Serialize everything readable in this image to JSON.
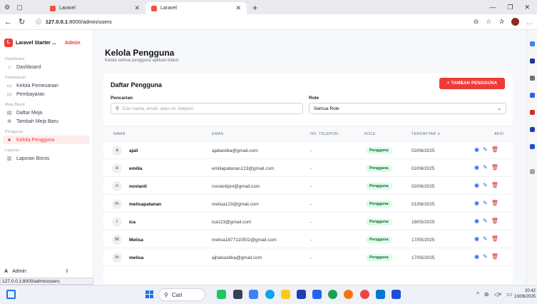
{
  "browser": {
    "tabs": [
      {
        "label": "Laravel",
        "active": false
      },
      {
        "label": "Laravel",
        "active": true
      }
    ],
    "url_host": "127.0.0.1",
    "url_rest": ":8000/admin/users",
    "status_url": "127.0.0.1:8000/admin/users"
  },
  "sidebar": {
    "brand": "Laravel Starter ...",
    "brand_tag": "Admin",
    "sections": [
      {
        "title": "Dashboard",
        "items": [
          {
            "label": "Dashboard",
            "icon": "home-icon"
          }
        ]
      },
      {
        "title": "Pemesanan",
        "items": [
          {
            "label": "Kelola Pemesanan",
            "icon": "calendar-icon"
          },
          {
            "label": "Pembayaran",
            "icon": "credit-card-icon"
          }
        ]
      },
      {
        "title": "Meja Bilard",
        "items": [
          {
            "label": "Daftar Meja",
            "icon": "table-icon"
          },
          {
            "label": "Tambah Meja Baru",
            "icon": "plus-circle-icon"
          }
        ]
      },
      {
        "title": "Pengguna",
        "items": [
          {
            "label": "Kelola Pengguna",
            "icon": "users-icon"
          }
        ]
      },
      {
        "title": "Laporan",
        "items": [
          {
            "label": "Laporan Bisnis",
            "icon": "chart-icon"
          }
        ]
      }
    ],
    "footer_avatar": "A",
    "footer_user": "Admin"
  },
  "page": {
    "title": "Kelola Pengguna",
    "subtitle": "Kelola semua pengguna aplikasi bilard."
  },
  "card": {
    "title": "Daftar Pengguna",
    "add_button": "+ TAMBAH PENGGUNA",
    "search_label": "Pencarian",
    "search_placeholder": "Cari nama, email, atau no. telepon",
    "role_label": "Role",
    "role_selected": "Semua Role"
  },
  "table": {
    "headers": {
      "name": "NAMA",
      "email": "EMAIL",
      "phone": "NO. TELEPON",
      "role": "ROLE",
      "registered": "TERDAFTAR ∨",
      "actions": "AKSI"
    },
    "rows": [
      {
        "initial": "a",
        "name": "ajali",
        "email": "ajaliastika@gmail.com",
        "phone": "-",
        "role": "Pengguna",
        "date": "02/06/2025"
      },
      {
        "initial": "e",
        "name": "emilia",
        "email": "emiliapatanan123@gmail.com",
        "phone": "-",
        "role": "Pengguna",
        "date": "02/06/2025"
      },
      {
        "initial": "n",
        "name": "novianti",
        "email": "noviantipiri@gmail.com",
        "phone": "-",
        "role": "Pengguna",
        "date": "02/06/2025"
      },
      {
        "initial": "m",
        "name": "melisapatanan",
        "email": "melisa123@gmail.com",
        "phone": "-",
        "role": "Pengguna",
        "date": "01/06/2025"
      },
      {
        "initial": "i",
        "name": "ica",
        "email": "ica123@gmail.com",
        "phone": "-",
        "role": "Pengguna",
        "date": "19/05/2025"
      },
      {
        "initial": "M",
        "name": "Melisa",
        "email": "melisa1877110502@gmail.com",
        "phone": "-",
        "role": "Pengguna",
        "date": "17/05/2025"
      },
      {
        "initial": "m",
        "name": "melisa",
        "email": "ajhalvastika@gmail.com",
        "phone": "-",
        "role": "Pengguna",
        "date": "17/05/2025"
      }
    ]
  },
  "taskbar": {
    "search": "Cari",
    "time": "20.42",
    "date": "13/06/2025"
  },
  "colors": {
    "accent": "#ef3b36",
    "badge_bg": "#dcfce7",
    "badge_text": "#166534"
  }
}
